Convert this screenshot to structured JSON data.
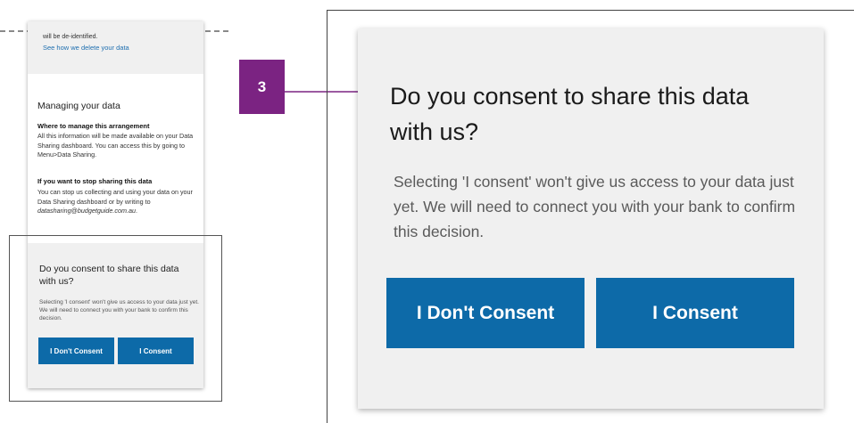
{
  "phone": {
    "top_text": "will be de-identified.",
    "top_link": "See how we delete your data",
    "managing_heading": "Managing your data",
    "where_heading": "Where to manage this arrangement",
    "where_text": "All this information will be made available on your Data Sharing dashboard. You can access this by going to Menu>Data Sharing.",
    "stop_heading": "If you want to stop sharing this data",
    "stop_text_prefix": "You can stop us collecting and using your data on your Data Sharing dashboard or by writing to ",
    "stop_email": "datasharing@budgetguide.com.au",
    "stop_text_suffix": ".",
    "consent_question": "Do you consent to share this data with us?",
    "consent_description": "Selecting 'I consent' won't give us access to your data just yet. We will need to connect you with your bank to confirm this decision.",
    "dont_consent_label": "I Don't Consent",
    "consent_label": "I Consent"
  },
  "step_badge": "3",
  "card": {
    "consent_question": "Do you consent to share this data with us?",
    "consent_description": "Selecting 'I consent' won't give us access to your data just yet. We will need to connect you with your bank to confirm this decision.",
    "dont_consent_label": "I Don't Consent",
    "consent_label": "I Consent"
  },
  "colors": {
    "button_blue": "#0d6aa8",
    "badge_purple": "#7b2382",
    "link_blue": "#1f6fb0"
  }
}
